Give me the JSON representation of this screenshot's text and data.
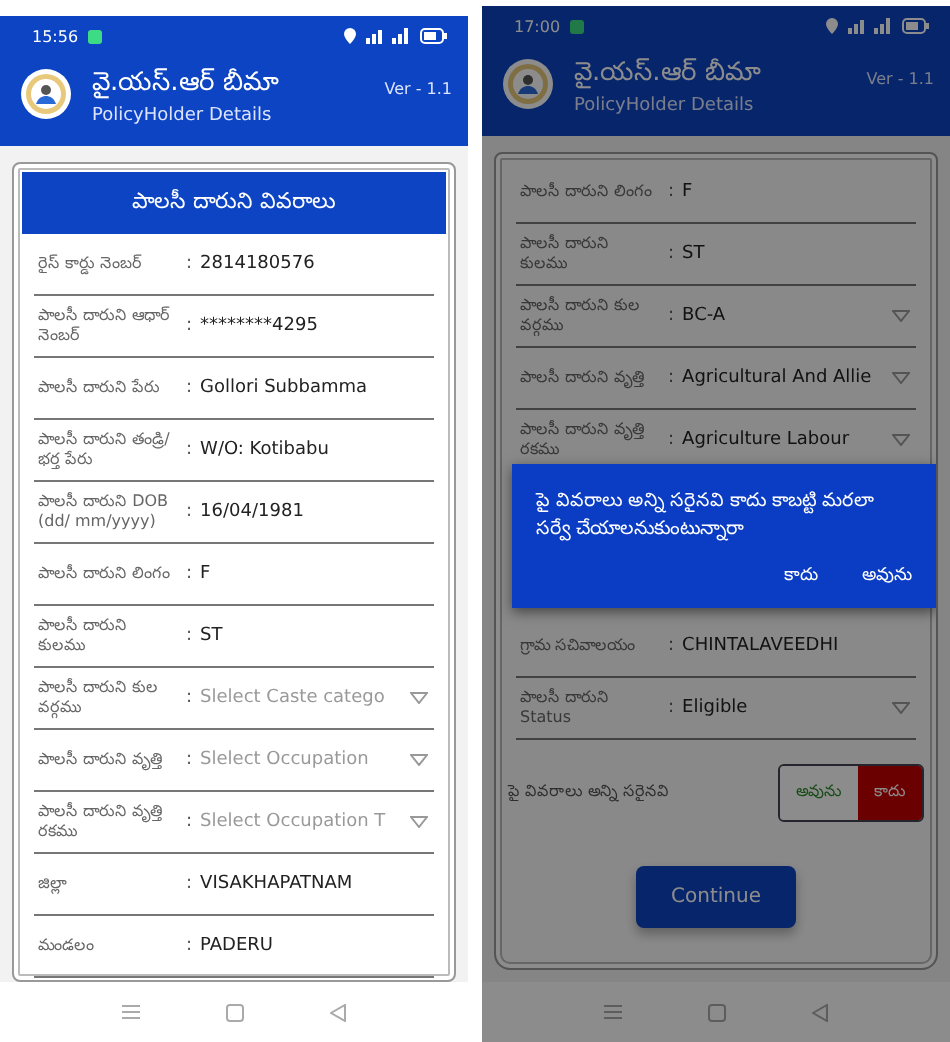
{
  "screens": [
    {
      "status": {
        "time": "15:56"
      },
      "app_bar": {
        "title": "వై.యస్.ఆర్ బీమా",
        "subtitle": "PolicyHolder Details",
        "version": "Ver - 1.1"
      },
      "card": {
        "title": "పాలసీ దారుని వివరాలు",
        "rows": [
          {
            "kind": "text",
            "label": "రైస్ కార్డు నెంబర్",
            "separator": ":",
            "value": "2814180576"
          },
          {
            "kind": "text",
            "label": "పాలసీ దారుని ఆధార్ నెంబర్",
            "separator": ":",
            "value": "********4295"
          },
          {
            "kind": "text",
            "label": "పాలసీ దారుని పేరు",
            "separator": ":",
            "value": "Gollori Subbamma"
          },
          {
            "kind": "text",
            "label": "పాలసీ దారుని తండ్రి/భర్త పేరు",
            "separator": ":",
            "value": "W/O: Kotibabu"
          },
          {
            "kind": "text",
            "label": "పాలసీ దారుని DOB (dd/ mm/yyyy)",
            "separator": ":",
            "value": "16/04/1981"
          },
          {
            "kind": "text",
            "label": "పాలసీ దారుని లింగం",
            "separator": ":",
            "value": "F"
          },
          {
            "kind": "text",
            "label": "పాలసీ దారుని కులము",
            "separator": ":",
            "value": "ST"
          },
          {
            "kind": "dropdown",
            "label": "పాలసీ దారుని కుల వర్గము",
            "separator": ":",
            "placeholder": "Slelect Caste catego"
          },
          {
            "kind": "dropdown",
            "label": "పాలసీ దారుని వృత్తి",
            "separator": ":",
            "placeholder": "Slelect Occupation"
          },
          {
            "kind": "dropdown",
            "label": "పాలసీ దారుని వృత్తి రకము",
            "separator": ":",
            "placeholder": "Slelect Occupation T"
          },
          {
            "kind": "text",
            "label": "జిల్లా",
            "separator": ":",
            "value": "VISAKHAPATNAM"
          },
          {
            "kind": "text",
            "label": "మండలం",
            "separator": ":",
            "value": "PADERU"
          }
        ]
      }
    },
    {
      "status": {
        "time": "17:00"
      },
      "app_bar": {
        "title": "వై.యస్.ఆర్ బీమా",
        "subtitle": "PolicyHolder Details",
        "version": "Ver - 1.1"
      },
      "card": {
        "rows": [
          {
            "kind": "text",
            "label": "పాలసీ దారుని లింగం",
            "separator": ":",
            "value": "F"
          },
          {
            "kind": "text",
            "label": "పాలసీ దారుని కులము",
            "separator": ":",
            "value": "ST"
          },
          {
            "kind": "dropdown",
            "label": "పాలసీ దారుని కుల వర్గము",
            "separator": ":",
            "value": "BC-A"
          },
          {
            "kind": "dropdown",
            "label": "పాలసీ దారుని వృత్తి",
            "separator": ":",
            "value": "Agricultural And Allie"
          },
          {
            "kind": "dropdown",
            "label": "పాలసీ దారుని వృత్తి రకము",
            "separator": ":",
            "value": "Agriculture Labour"
          },
          {
            "kind": "text",
            "label": "గ్రామ సచివాలయం",
            "separator": ":",
            "value": "CHINTALAVEEDHI"
          },
          {
            "kind": "dropdown",
            "label": "పాలసీ దారుని Status",
            "separator": ":",
            "value": "Eligible"
          }
        ],
        "confirm": {
          "label": "పై వివరాలు అన్ని సరైనవి",
          "options": [
            {
              "label": "అవును",
              "selected": false
            },
            {
              "label": "కాదు",
              "selected": true
            }
          ]
        },
        "continue_button": "Continue"
      },
      "dialog": {
        "message": "పై వివరాలు అన్ని సరైనవి కాదు కాబట్టి మరలా సర్వే చేయాలనుకుంటున్నారా",
        "buttons": [
          "కాదు",
          "అవును"
        ]
      }
    }
  ]
}
